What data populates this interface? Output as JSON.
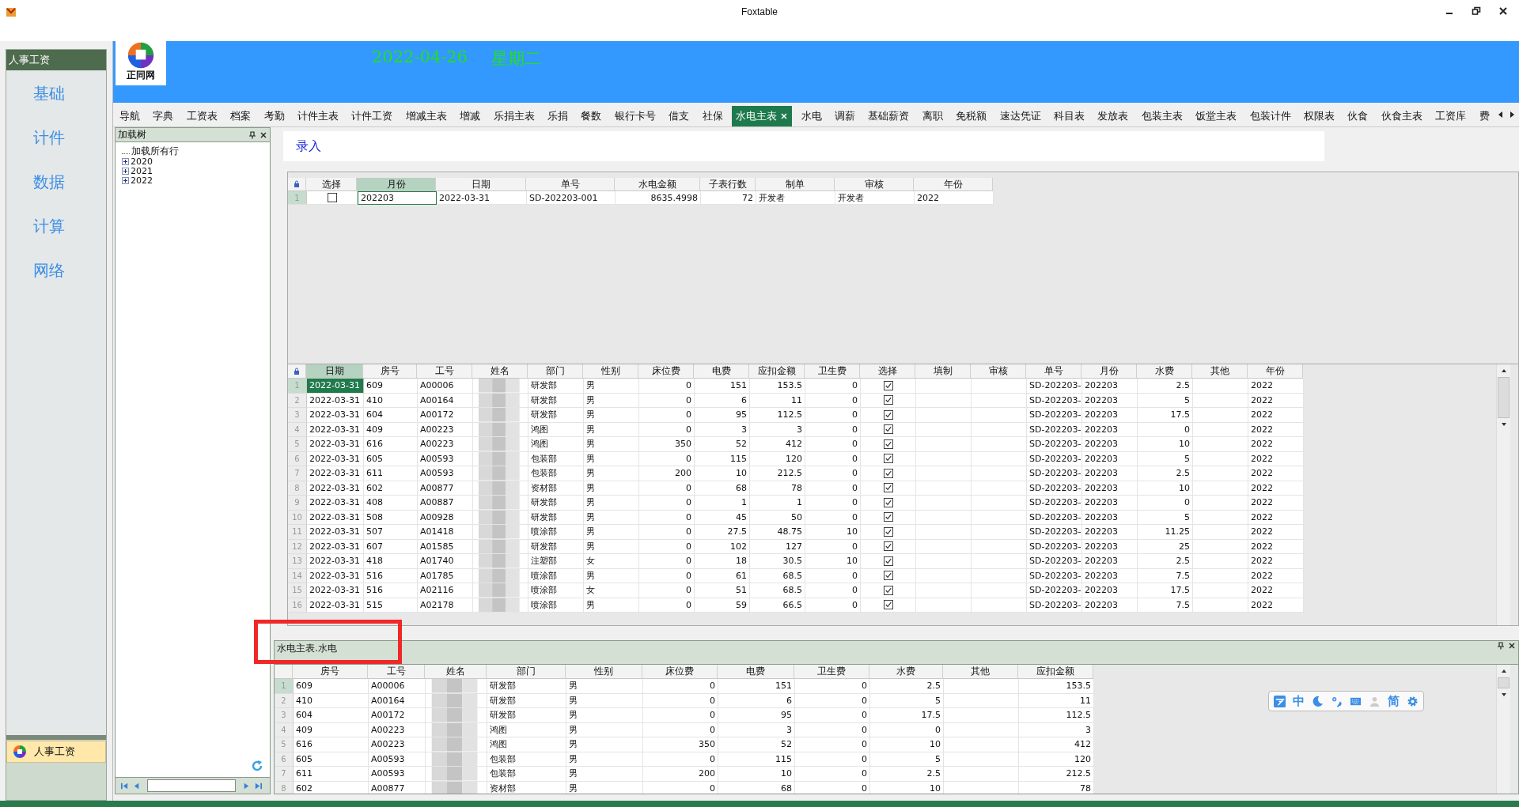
{
  "window": {
    "title": "Foxtable"
  },
  "sidebar": {
    "title": "人事工资",
    "items": [
      {
        "label": "基础",
        "selected": false
      },
      {
        "label": "计件",
        "selected": false
      },
      {
        "label": "数据",
        "selected": false
      },
      {
        "label": "计算",
        "selected": false
      },
      {
        "label": "网络",
        "selected": false
      }
    ],
    "footer_item": {
      "label": "人事工资",
      "selected": true
    }
  },
  "header": {
    "logo_text": "正同网",
    "date": "2022-04-26",
    "weekday": "星期二"
  },
  "tabs": [
    {
      "label": "导航",
      "selected": false
    },
    {
      "label": "字典",
      "selected": false
    },
    {
      "label": "工资表",
      "selected": false
    },
    {
      "label": "档案",
      "selected": false
    },
    {
      "label": "考勤",
      "selected": false
    },
    {
      "label": "计件主表",
      "selected": false
    },
    {
      "label": "计件工资",
      "selected": false
    },
    {
      "label": "增减主表",
      "selected": false
    },
    {
      "label": "增减",
      "selected": false
    },
    {
      "label": "乐捐主表",
      "selected": false
    },
    {
      "label": "乐捐",
      "selected": false
    },
    {
      "label": "餐数",
      "selected": false
    },
    {
      "label": "银行卡号",
      "selected": false
    },
    {
      "label": "借支",
      "selected": false
    },
    {
      "label": "社保",
      "selected": false
    },
    {
      "label": "水电主表",
      "selected": true
    },
    {
      "label": "水电",
      "selected": false
    },
    {
      "label": "调薪",
      "selected": false
    },
    {
      "label": "基础薪资",
      "selected": false
    },
    {
      "label": "离职",
      "selected": false
    },
    {
      "label": "免税额",
      "selected": false
    },
    {
      "label": "速达凭证",
      "selected": false
    },
    {
      "label": "科目表",
      "selected": false
    },
    {
      "label": "发放表",
      "selected": false
    },
    {
      "label": "包装主表",
      "selected": false
    },
    {
      "label": "饭堂主表",
      "selected": false
    },
    {
      "label": "包装计件",
      "selected": false
    },
    {
      "label": "权限表",
      "selected": false
    },
    {
      "label": "伙食",
      "selected": false
    },
    {
      "label": "伙食主表",
      "selected": false
    },
    {
      "label": "工资库",
      "selected": false
    },
    {
      "label": "费",
      "selected": false
    }
  ],
  "tree_panel": {
    "title": "加载树",
    "items": [
      {
        "label": "加载所有行",
        "expandable": false
      },
      {
        "label": "2020",
        "expandable": true
      },
      {
        "label": "2021",
        "expandable": true
      },
      {
        "label": "2022",
        "expandable": true
      }
    ]
  },
  "entry_button": "录入",
  "master_table": {
    "editing": true,
    "columns": [
      {
        "label": "选择",
        "kind": "check",
        "current": false
      },
      {
        "label": "月份",
        "kind": "text",
        "current": true
      },
      {
        "label": "日期",
        "kind": "text",
        "current": false
      },
      {
        "label": "单号",
        "kind": "text",
        "current": false
      },
      {
        "label": "水电金额",
        "kind": "num",
        "current": false
      },
      {
        "label": "子表行数",
        "kind": "num",
        "current": false
      },
      {
        "label": "制单",
        "kind": "text",
        "current": false
      },
      {
        "label": "审核",
        "kind": "text",
        "current": false
      },
      {
        "label": "年份",
        "kind": "text",
        "current": false
      }
    ],
    "rows": [
      {
        "no": "1",
        "selected": true,
        "checked": false,
        "cells": [
          "",
          "202203",
          "2022-03-31",
          "SD-202203-001",
          "8635.4998",
          "72",
          "开发者",
          "开发者",
          "2022"
        ]
      }
    ]
  },
  "detail_table": {
    "editing": false,
    "columns": [
      {
        "label": "日期",
        "kind": "text",
        "current": true
      },
      {
        "label": "房号",
        "kind": "text",
        "current": false
      },
      {
        "label": "工号",
        "kind": "text",
        "current": false
      },
      {
        "label": "姓名",
        "kind": "masked",
        "current": false
      },
      {
        "label": "部门",
        "kind": "text",
        "current": false
      },
      {
        "label": "性别",
        "kind": "text",
        "current": false
      },
      {
        "label": "床位费",
        "kind": "num",
        "current": false
      },
      {
        "label": "电费",
        "kind": "num",
        "current": false
      },
      {
        "label": "应扣金额",
        "kind": "num",
        "current": false
      },
      {
        "label": "卫生费",
        "kind": "num",
        "current": false
      },
      {
        "label": "选择",
        "kind": "check",
        "current": false
      },
      {
        "label": "填制",
        "kind": "blank",
        "current": false
      },
      {
        "label": "审核",
        "kind": "blank",
        "current": false
      },
      {
        "label": "单号",
        "kind": "text",
        "current": false
      },
      {
        "label": "月份",
        "kind": "text",
        "current": false
      },
      {
        "label": "水费",
        "kind": "num",
        "current": false
      },
      {
        "label": "其他",
        "kind": "blank",
        "current": false
      },
      {
        "label": "年份",
        "kind": "text",
        "current": false
      }
    ],
    "rows": [
      {
        "no": "1",
        "selected": true,
        "checked": true,
        "cells": [
          "2022-03-31",
          "609",
          "A00006",
          "",
          "研发部",
          "男",
          "0",
          "151",
          "153.5",
          "0",
          "",
          "",
          "",
          "SD-202203-",
          "202203",
          "2.5",
          "",
          "2022"
        ]
      },
      {
        "no": "2",
        "selected": false,
        "checked": true,
        "cells": [
          "2022-03-31",
          "410",
          "A00164",
          "",
          "研发部",
          "男",
          "0",
          "6",
          "11",
          "0",
          "",
          "",
          "",
          "SD-202203-",
          "202203",
          "5",
          "",
          "2022"
        ]
      },
      {
        "no": "3",
        "selected": false,
        "checked": true,
        "cells": [
          "2022-03-31",
          "604",
          "A00172",
          "",
          "研发部",
          "男",
          "0",
          "95",
          "112.5",
          "0",
          "",
          "",
          "",
          "SD-202203-",
          "202203",
          "17.5",
          "",
          "2022"
        ]
      },
      {
        "no": "4",
        "selected": false,
        "checked": true,
        "cells": [
          "2022-03-31",
          "409",
          "A00223",
          "",
          "鸿图",
          "男",
          "0",
          "3",
          "3",
          "0",
          "",
          "",
          "",
          "SD-202203-",
          "202203",
          "0",
          "",
          "2022"
        ]
      },
      {
        "no": "5",
        "selected": false,
        "checked": true,
        "cells": [
          "2022-03-31",
          "616",
          "A00223",
          "",
          "鸿图",
          "男",
          "350",
          "52",
          "412",
          "0",
          "",
          "",
          "",
          "SD-202203-",
          "202203",
          "10",
          "",
          "2022"
        ]
      },
      {
        "no": "6",
        "selected": false,
        "checked": true,
        "cells": [
          "2022-03-31",
          "605",
          "A00593",
          "",
          "包装部",
          "男",
          "0",
          "115",
          "120",
          "0",
          "",
          "",
          "",
          "SD-202203-",
          "202203",
          "5",
          "",
          "2022"
        ]
      },
      {
        "no": "7",
        "selected": false,
        "checked": true,
        "cells": [
          "2022-03-31",
          "611",
          "A00593",
          "",
          "包装部",
          "男",
          "200",
          "10",
          "212.5",
          "0",
          "",
          "",
          "",
          "SD-202203-",
          "202203",
          "2.5",
          "",
          "2022"
        ]
      },
      {
        "no": "8",
        "selected": false,
        "checked": true,
        "cells": [
          "2022-03-31",
          "602",
          "A00877",
          "",
          "资材部",
          "男",
          "0",
          "68",
          "78",
          "0",
          "",
          "",
          "",
          "SD-202203-",
          "202203",
          "10",
          "",
          "2022"
        ]
      },
      {
        "no": "9",
        "selected": false,
        "checked": true,
        "cells": [
          "2022-03-31",
          "408",
          "A00887",
          "",
          "研发部",
          "男",
          "0",
          "1",
          "1",
          "0",
          "",
          "",
          "",
          "SD-202203-",
          "202203",
          "0",
          "",
          "2022"
        ]
      },
      {
        "no": "10",
        "selected": false,
        "checked": true,
        "cells": [
          "2022-03-31",
          "508",
          "A00928",
          "",
          "研发部",
          "男",
          "0",
          "45",
          "50",
          "0",
          "",
          "",
          "",
          "SD-202203-",
          "202203",
          "5",
          "",
          "2022"
        ]
      },
      {
        "no": "11",
        "selected": false,
        "checked": true,
        "cells": [
          "2022-03-31",
          "507",
          "A01418",
          "",
          "喷涂部",
          "男",
          "0",
          "27.5",
          "48.75",
          "10",
          "",
          "",
          "",
          "SD-202203-",
          "202203",
          "11.25",
          "",
          "2022"
        ]
      },
      {
        "no": "12",
        "selected": false,
        "checked": true,
        "cells": [
          "2022-03-31",
          "607",
          "A01585",
          "",
          "研发部",
          "男",
          "0",
          "102",
          "127",
          "0",
          "",
          "",
          "",
          "SD-202203-",
          "202203",
          "25",
          "",
          "2022"
        ]
      },
      {
        "no": "13",
        "selected": false,
        "checked": true,
        "cells": [
          "2022-03-31",
          "418",
          "A01740",
          "",
          "注塑部",
          "女",
          "0",
          "18",
          "30.5",
          "10",
          "",
          "",
          "",
          "SD-202203-",
          "202203",
          "2.5",
          "",
          "2022"
        ]
      },
      {
        "no": "14",
        "selected": false,
        "checked": true,
        "cells": [
          "2022-03-31",
          "516",
          "A01785",
          "",
          "喷涂部",
          "男",
          "0",
          "61",
          "68.5",
          "0",
          "",
          "",
          "",
          "SD-202203-",
          "202203",
          "7.5",
          "",
          "2022"
        ]
      },
      {
        "no": "15",
        "selected": false,
        "checked": true,
        "cells": [
          "2022-03-31",
          "516",
          "A02116",
          "",
          "喷涂部",
          "女",
          "0",
          "51",
          "68.5",
          "0",
          "",
          "",
          "",
          "SD-202203-",
          "202203",
          "17.5",
          "",
          "2022"
        ]
      },
      {
        "no": "16",
        "selected": false,
        "checked": true,
        "cells": [
          "2022-03-31",
          "515",
          "A02178",
          "",
          "喷涂部",
          "男",
          "0",
          "59",
          "66.5",
          "0",
          "",
          "",
          "",
          "SD-202203-",
          "202203",
          "7.5",
          "",
          "2022"
        ]
      }
    ]
  },
  "sub_panel": {
    "title": "水电主表.水电",
    "table": {
      "columns": [
        {
          "label": "房号",
          "kind": "text",
          "current": false
        },
        {
          "label": "工号",
          "kind": "text",
          "current": false
        },
        {
          "label": "姓名",
          "kind": "masked",
          "current": false
        },
        {
          "label": "部门",
          "kind": "text",
          "current": false
        },
        {
          "label": "性别",
          "kind": "text",
          "current": false
        },
        {
          "label": "床位费",
          "kind": "num",
          "current": false
        },
        {
          "label": "电费",
          "kind": "num",
          "current": false
        },
        {
          "label": "卫生费",
          "kind": "num",
          "current": false
        },
        {
          "label": "水费",
          "kind": "num",
          "current": false
        },
        {
          "label": "其他",
          "kind": "blank",
          "current": false
        },
        {
          "label": "应扣金额",
          "kind": "num",
          "current": false
        }
      ],
      "rows": [
        {
          "no": "1",
          "selected": true,
          "cells": [
            "609",
            "A00006",
            "",
            "研发部",
            "男",
            "0",
            "151",
            "0",
            "2.5",
            "",
            "153.5"
          ]
        },
        {
          "no": "2",
          "selected": false,
          "cells": [
            "410",
            "A00164",
            "",
            "研发部",
            "男",
            "0",
            "6",
            "0",
            "5",
            "",
            "11"
          ]
        },
        {
          "no": "3",
          "selected": false,
          "cells": [
            "604",
            "A00172",
            "",
            "研发部",
            "男",
            "0",
            "95",
            "0",
            "17.5",
            "",
            "112.5"
          ]
        },
        {
          "no": "4",
          "selected": false,
          "cells": [
            "409",
            "A00223",
            "",
            "鸿图",
            "男",
            "0",
            "3",
            "0",
            "0",
            "",
            "3"
          ]
        },
        {
          "no": "5",
          "selected": false,
          "cells": [
            "616",
            "A00223",
            "",
            "鸿图",
            "男",
            "350",
            "52",
            "0",
            "10",
            "",
            "412"
          ]
        },
        {
          "no": "6",
          "selected": false,
          "cells": [
            "605",
            "A00593",
            "",
            "包装部",
            "男",
            "0",
            "115",
            "0",
            "5",
            "",
            "120"
          ]
        },
        {
          "no": "7",
          "selected": false,
          "cells": [
            "611",
            "A00593",
            "",
            "包装部",
            "男",
            "200",
            "10",
            "0",
            "2.5",
            "",
            "212.5"
          ]
        },
        {
          "no": "8",
          "selected": false,
          "cells": [
            "602",
            "A00877",
            "",
            "资材部",
            "男",
            "0",
            "68",
            "0",
            "10",
            "",
            "78"
          ]
        }
      ]
    }
  },
  "ime_toolbar": {
    "mode": "中",
    "script": "简"
  }
}
